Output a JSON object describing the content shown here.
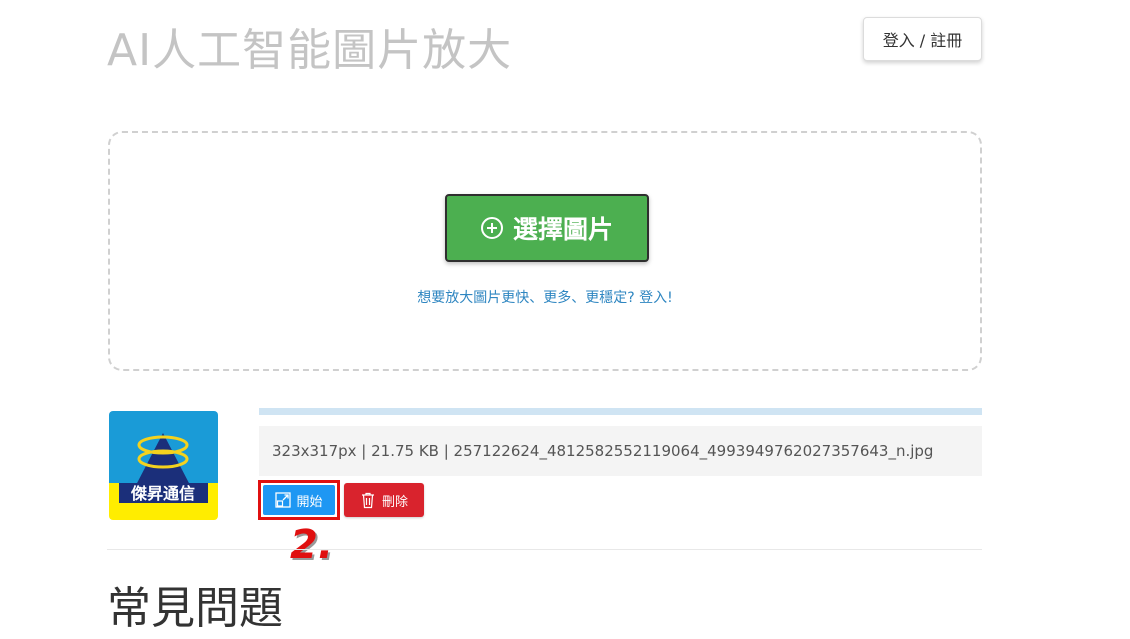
{
  "header": {
    "title": "AI人工智能圖片放大",
    "login_label": "登入 / 註冊"
  },
  "upload": {
    "choose_label": "選擇圖片",
    "hint": "想要放大圖片更快、更多、更穩定? 登入!"
  },
  "file": {
    "info": "323x317px | 21.75 KB | 257122624_4812582552119064_4993949762027357643_n.jpg",
    "thumbnail_text": "傑昇通信",
    "progress": 1.0,
    "start_label": "開始",
    "delete_label": "刪除"
  },
  "annotation": {
    "step": "2."
  },
  "faq": {
    "title": "常見問題"
  },
  "colors": {
    "choose_button": "#4caf50",
    "start_button": "#1e97f3",
    "delete_button": "#d9232d",
    "highlight": "#e01010",
    "link": "#2e86c1"
  },
  "icons": {
    "choose": "plus-circle-icon",
    "start": "expand-icon",
    "delete": "trash-icon"
  }
}
